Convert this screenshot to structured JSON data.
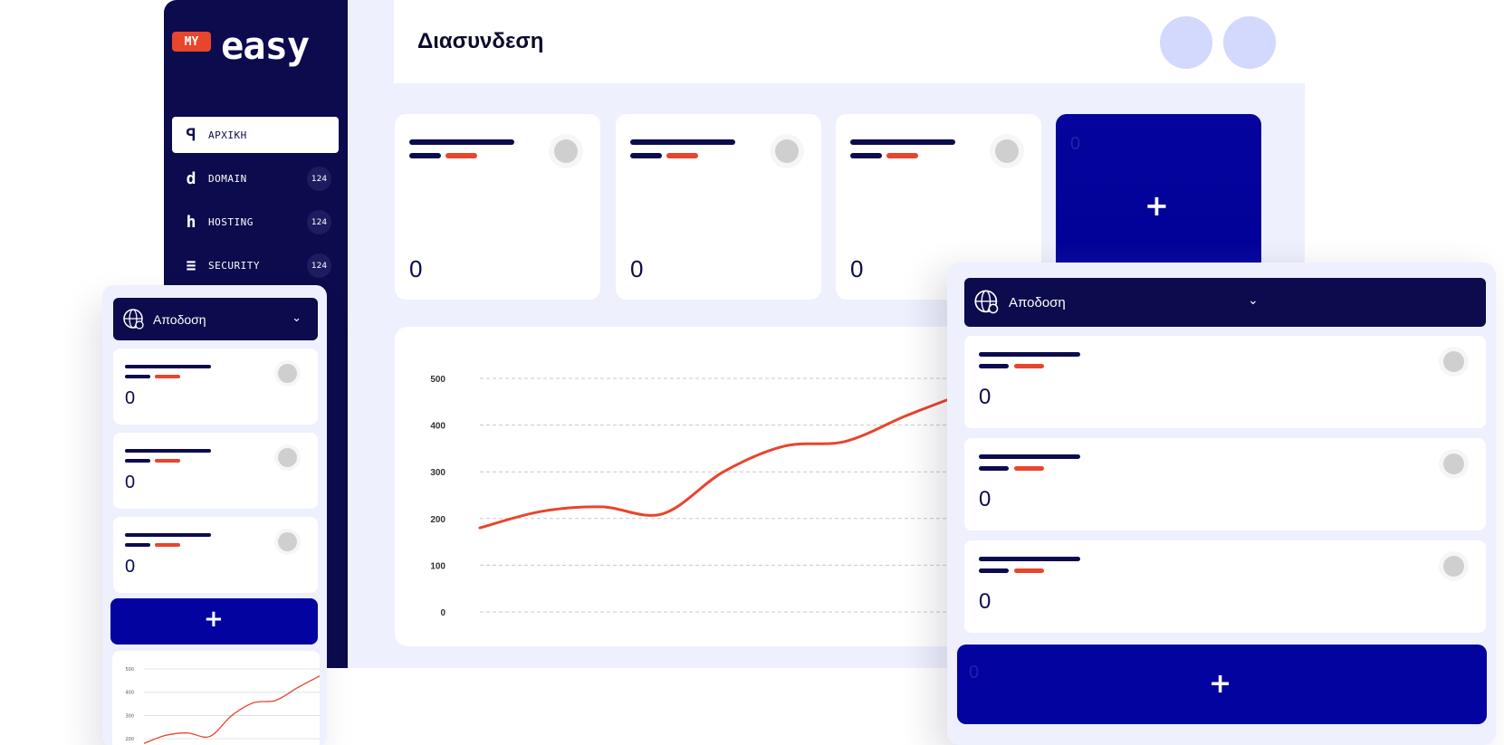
{
  "brand": {
    "badge": "MY",
    "name": "easy"
  },
  "sidebar": {
    "items": [
      {
        "icon": "home-icon",
        "glyph": "ꟼ",
        "label": "ΑΡΧΙΚΗ",
        "badge": ""
      },
      {
        "icon": "domain-icon",
        "glyph": "d",
        "label": "DOMAIN",
        "badge": "124"
      },
      {
        "icon": "hosting-icon",
        "glyph": "h",
        "label": "HOSTING",
        "badge": "124"
      },
      {
        "icon": "security-icon",
        "glyph": "≡",
        "label": "SECURITY",
        "badge": "124"
      }
    ]
  },
  "header": {
    "title": "Διασυνδεση"
  },
  "stats": [
    {
      "value": "0"
    },
    {
      "value": "0"
    },
    {
      "value": "0"
    }
  ],
  "add_card": {
    "label": "+",
    "ghost": "0"
  },
  "left_panel": {
    "dropdown": "Αποδοση",
    "cards": [
      {
        "value": "0"
      },
      {
        "value": "0"
      },
      {
        "value": "0"
      }
    ],
    "add_label": "+"
  },
  "right_panel": {
    "dropdown": "Αποδοση",
    "cards": [
      {
        "value": "0"
      },
      {
        "value": "0"
      },
      {
        "value": "0"
      }
    ],
    "add_label": "+",
    "ghost": "0"
  },
  "colors": {
    "navy": "#0b0b4d",
    "accent": "#e8452c",
    "blue": "#03039f",
    "bg": "#eef0fd"
  },
  "chart_data": {
    "type": "line",
    "y_ticks": [
      "500",
      "400",
      "300",
      "200",
      "100",
      "0"
    ],
    "ylim": [
      0,
      500
    ],
    "grid": true,
    "series": [
      {
        "color": "#e8452c",
        "x": [
          0,
          1,
          2,
          3,
          4,
          5,
          6,
          7,
          8
        ],
        "values": [
          180,
          215,
          225,
          210,
          300,
          355,
          365,
          420,
          470
        ]
      }
    ]
  }
}
